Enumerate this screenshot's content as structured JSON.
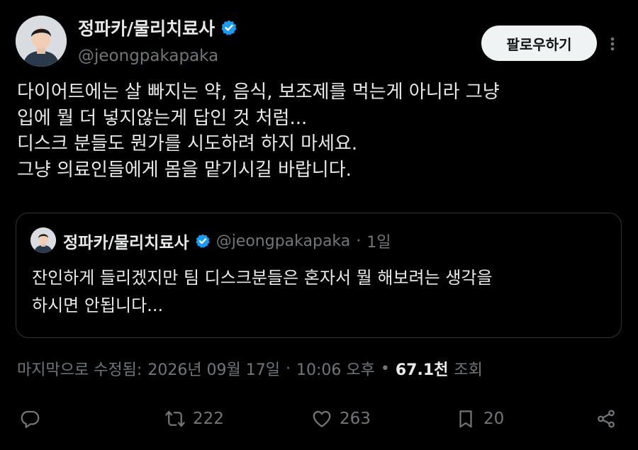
{
  "author": {
    "display_name": "정파카/물리치료사",
    "handle": "@jeongpakapaka",
    "verified": true,
    "avatar_icon": "avatar-photo"
  },
  "follow_button": {
    "label": "팔로우하기"
  },
  "more_icon": "more-vertical-icon",
  "tweet": {
    "lines": [
      "다이어트에는 살 빠지는 약, 음식, 보조제를 먹는게 아니라 그냥",
      "입에 뭘 더 넣지않는게 답인 것 처럼...",
      "디스크 분들도 뭔가를 시도하려 하지 마세요.",
      "그냥 의료인들에게 몸을 맡기시길 바랍니다."
    ]
  },
  "quoted": {
    "display_name": "정파카/물리치료사",
    "handle": "@jeongpakapaka",
    "separator": "·",
    "time": "1일",
    "lines": [
      "잔인하게 들리겠지만 팀 디스크분들은 혼자서 뭘 해보려는 생각을",
      "하시면 안됩니다..."
    ]
  },
  "meta": {
    "edited_label": "마지막으로 수정됨:",
    "date": "2026년 09월 17일",
    "separator": "·",
    "time": "10:06 오후",
    "bullet": "•",
    "views_count": "67.1천",
    "views_label": "조회"
  },
  "actions": {
    "reply": {
      "icon": "reply-icon",
      "count": ""
    },
    "retweet": {
      "icon": "retweet-icon",
      "count": "222"
    },
    "like": {
      "icon": "heart-icon",
      "count": "263"
    },
    "bookmark": {
      "icon": "bookmark-icon",
      "count": "20"
    },
    "share": {
      "icon": "share-icon",
      "count": ""
    }
  },
  "colors": {
    "background": "#000000",
    "text": "#e7e9ea",
    "secondary_text": "#71767b",
    "verified": "#1d9bf0",
    "follow_button_bg": "#eff3f4",
    "border": "#2f3336"
  }
}
